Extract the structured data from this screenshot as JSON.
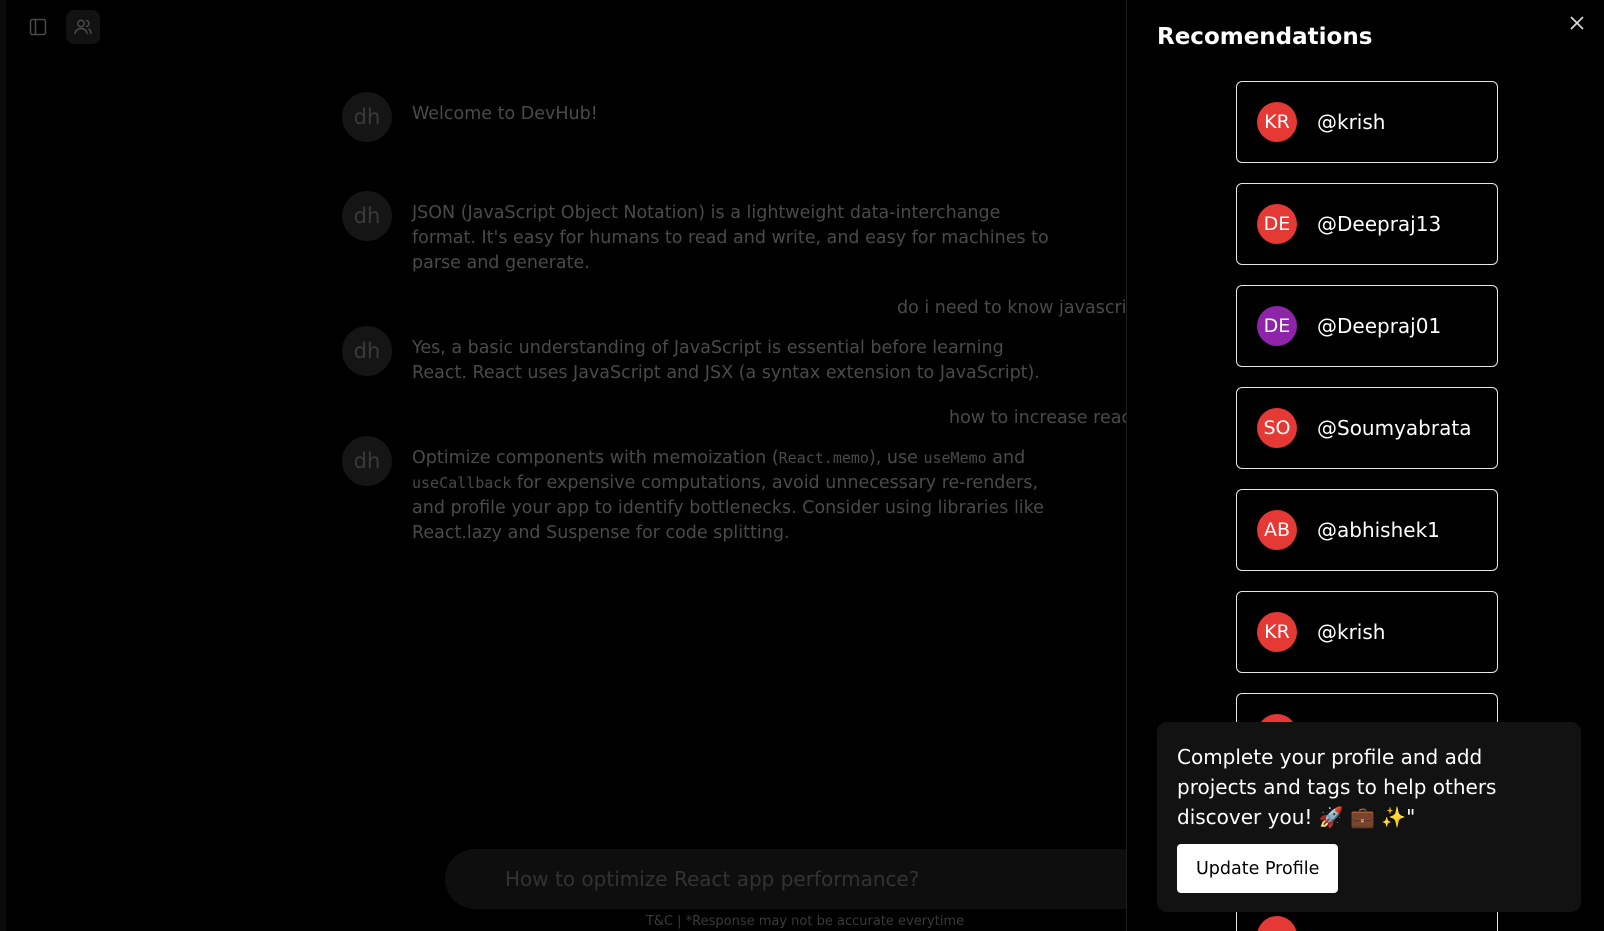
{
  "chat": {
    "messages": [
      {
        "role": "bot",
        "avatar": "dh",
        "text": "Welcome to DevHub!"
      },
      {
        "role": "bot",
        "avatar": "dh",
        "text": "JSON (JavaScript Object Notation) is a lightweight data-interchange format. It's easy for humans to read and write, and easy for machines to parse and generate."
      },
      {
        "role": "user",
        "text": "do i need to know javascri"
      },
      {
        "role": "bot",
        "avatar": "dh",
        "text": "Yes, a basic understanding of JavaScript is essential before learning React. React uses JavaScript and JSX (a syntax extension to JavaScript)."
      },
      {
        "role": "user",
        "text": "how to increase reac"
      },
      {
        "role": "bot",
        "avatar": "dh",
        "text_parts": [
          "Optimize components with memoization (",
          "React.memo",
          "), use ",
          "useMemo",
          " and ",
          "useCallback",
          " for expensive computations, avoid unnecessary re-renders, and profile your app to identify bottlenecks. Consider using libraries like React.lazy and Suspense for code splitting."
        ]
      }
    ],
    "input_placeholder": "How to optimize React app performance?",
    "footer_note": "T&C | *Response may not be accurate everytime"
  },
  "drawer": {
    "title": "Recomendations",
    "recommendations": [
      {
        "initials": "KR",
        "handle": "@krish",
        "avatar_color": "#e53935"
      },
      {
        "initials": "DE",
        "handle": "@Deepraj13",
        "avatar_color": "#e53935"
      },
      {
        "initials": "DE",
        "handle": "@Deepraj01",
        "avatar_color": "#8e24aa"
      },
      {
        "initials": "SO",
        "handle": "@Soumyabrata",
        "avatar_color": "#e53935"
      },
      {
        "initials": "AB",
        "handle": "@abhishek1",
        "avatar_color": "#e53935"
      },
      {
        "initials": "KR",
        "handle": "@krish",
        "avatar_color": "#e53935"
      }
    ],
    "popup": {
      "text": "Complete your profile and add projects and tags to help others discover you! 🚀 💼 ✨\"",
      "button_label": "Update Profile"
    }
  },
  "icons": {
    "sidebar_toggle": "sidebar-toggle-icon",
    "users": "users-icon",
    "close": "close-icon"
  }
}
